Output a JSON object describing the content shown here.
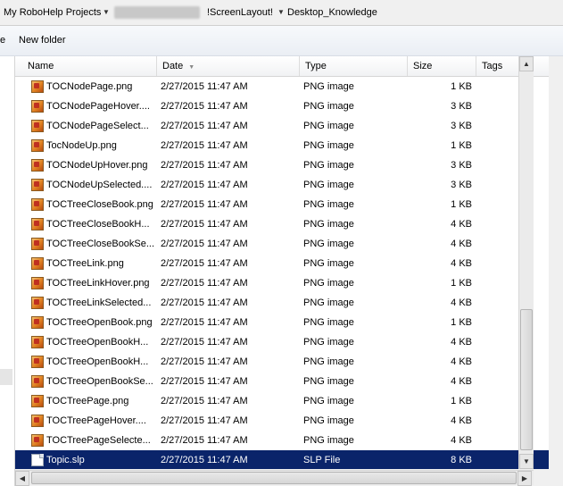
{
  "breadcrumb": {
    "items": [
      "My RoboHelp Projects",
      "!ScreenLayout!",
      "Desktop_Knowledge"
    ]
  },
  "toolbar": {
    "partial_left_label": "e",
    "new_folder_label": "New folder"
  },
  "columns": {
    "name": "Name",
    "date": "Date",
    "type": "Type",
    "size": "Size",
    "tags": "Tags"
  },
  "files": [
    {
      "name": "TOCNodePage.png",
      "date": "2/27/2015 11:47 AM",
      "type": "PNG image",
      "size": "1 KB",
      "icon": "png-file-icon"
    },
    {
      "name": "TOCNodePageHover....",
      "date": "2/27/2015 11:47 AM",
      "type": "PNG image",
      "size": "3 KB",
      "icon": "png-file-icon"
    },
    {
      "name": "TOCNodePageSelect...",
      "date": "2/27/2015 11:47 AM",
      "type": "PNG image",
      "size": "3 KB",
      "icon": "png-file-icon"
    },
    {
      "name": "TocNodeUp.png",
      "date": "2/27/2015 11:47 AM",
      "type": "PNG image",
      "size": "1 KB",
      "icon": "png-file-icon"
    },
    {
      "name": "TOCNodeUpHover.png",
      "date": "2/27/2015 11:47 AM",
      "type": "PNG image",
      "size": "3 KB",
      "icon": "png-file-icon"
    },
    {
      "name": "TOCNodeUpSelected....",
      "date": "2/27/2015 11:47 AM",
      "type": "PNG image",
      "size": "3 KB",
      "icon": "png-file-icon"
    },
    {
      "name": "TOCTreeCloseBook.png",
      "date": "2/27/2015 11:47 AM",
      "type": "PNG image",
      "size": "1 KB",
      "icon": "png-file-icon"
    },
    {
      "name": "TOCTreeCloseBookH...",
      "date": "2/27/2015 11:47 AM",
      "type": "PNG image",
      "size": "4 KB",
      "icon": "png-file-icon"
    },
    {
      "name": "TOCTreeCloseBookSe...",
      "date": "2/27/2015 11:47 AM",
      "type": "PNG image",
      "size": "4 KB",
      "icon": "png-file-icon"
    },
    {
      "name": "TOCTreeLink.png",
      "date": "2/27/2015 11:47 AM",
      "type": "PNG image",
      "size": "4 KB",
      "icon": "png-file-icon"
    },
    {
      "name": "TOCTreeLinkHover.png",
      "date": "2/27/2015 11:47 AM",
      "type": "PNG image",
      "size": "1 KB",
      "icon": "png-file-icon"
    },
    {
      "name": "TOCTreeLinkSelected...",
      "date": "2/27/2015 11:47 AM",
      "type": "PNG image",
      "size": "4 KB",
      "icon": "png-file-icon"
    },
    {
      "name": "TOCTreeOpenBook.png",
      "date": "2/27/2015 11:47 AM",
      "type": "PNG image",
      "size": "1 KB",
      "icon": "png-file-icon"
    },
    {
      "name": "TOCTreeOpenBookH...",
      "date": "2/27/2015 11:47 AM",
      "type": "PNG image",
      "size": "4 KB",
      "icon": "png-file-icon"
    },
    {
      "name": "TOCTreeOpenBookH...",
      "date": "2/27/2015 11:47 AM",
      "type": "PNG image",
      "size": "4 KB",
      "icon": "png-file-icon"
    },
    {
      "name": "TOCTreeOpenBookSe...",
      "date": "2/27/2015 11:47 AM",
      "type": "PNG image",
      "size": "4 KB",
      "icon": "png-file-icon"
    },
    {
      "name": "TOCTreePage.png",
      "date": "2/27/2015 11:47 AM",
      "type": "PNG image",
      "size": "1 KB",
      "icon": "png-file-icon"
    },
    {
      "name": "TOCTreePageHover....",
      "date": "2/27/2015 11:47 AM",
      "type": "PNG image",
      "size": "4 KB",
      "icon": "png-file-icon"
    },
    {
      "name": "TOCTreePageSelecte...",
      "date": "2/27/2015 11:47 AM",
      "type": "PNG image",
      "size": "4 KB",
      "icon": "png-file-icon"
    },
    {
      "name": "Topic.slp",
      "date": "2/27/2015 11:47 AM",
      "type": "SLP File",
      "size": "8 KB",
      "icon": "document-file-icon",
      "selected": true
    }
  ],
  "colors": {
    "selection": "#0a246a",
    "selection_text": "#ffffff"
  }
}
